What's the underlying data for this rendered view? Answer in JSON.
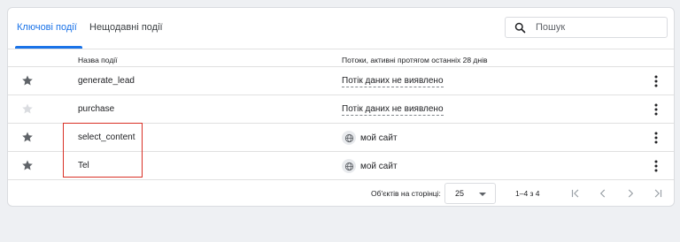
{
  "tabs": [
    {
      "label": "Ключові події",
      "active": true
    },
    {
      "label": "Нещодавні події",
      "active": false
    }
  ],
  "search": {
    "placeholder": "Пошук",
    "value": ""
  },
  "table": {
    "columns": [
      "Назва події",
      "Потоки, активні протягом останніх 28 днів"
    ],
    "rows": [
      {
        "name": "generate_lead",
        "stream": "Потік даних не виявлено",
        "starred": true
      },
      {
        "name": "purchase",
        "stream": "Потік даних не виявлено",
        "starred": false
      },
      {
        "name": "select_content",
        "stream": "мой сайт",
        "starred": true
      },
      {
        "name": "Tel",
        "stream": "мой сайт",
        "starred": true
      }
    ]
  },
  "pagination": {
    "per_page_label": "Об'єктів на сторінці:",
    "per_page_value": "25",
    "range": "1–4 з 4"
  },
  "colors": {
    "accent": "#1a73e8",
    "star_active": "#5f6368",
    "star_inactive": "#dadce0",
    "highlight_box": "#d93025"
  },
  "icons": [
    "search-icon",
    "star-icon",
    "globe-icon",
    "more-vert-icon",
    "first-page-icon",
    "prev-page-icon",
    "next-page-icon",
    "last-page-icon"
  ]
}
